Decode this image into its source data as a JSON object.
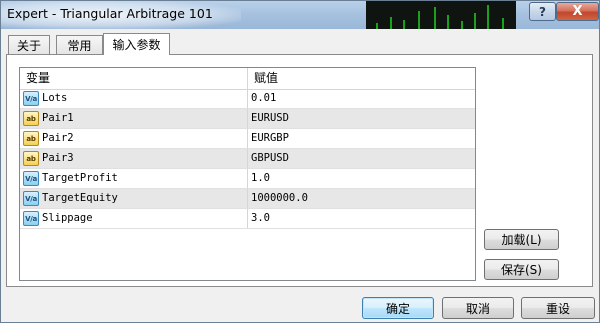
{
  "window": {
    "title": "Expert - Triangular Arbitrage 101",
    "help_label": "?",
    "close_label": "X"
  },
  "tabs": [
    {
      "label": "关于"
    },
    {
      "label": "常用"
    },
    {
      "label": "输入参数"
    }
  ],
  "active_tab": "输入参数",
  "grid": {
    "headers": {
      "name": "变量",
      "value": "赋值"
    },
    "rows": [
      {
        "type": "Val",
        "icon_text": "V/a",
        "name": "Lots",
        "value": "0.01"
      },
      {
        "type": "ab",
        "icon_text": "ab",
        "name": "Pair1",
        "value": "EURUSD"
      },
      {
        "type": "ab",
        "icon_text": "ab",
        "name": "Pair2",
        "value": "EURGBP"
      },
      {
        "type": "ab",
        "icon_text": "ab",
        "name": "Pair3",
        "value": "GBPUSD"
      },
      {
        "type": "Val",
        "icon_text": "V/a",
        "name": "TargetProfit",
        "value": "1.0"
      },
      {
        "type": "Val",
        "icon_text": "V/a",
        "name": "TargetEquity",
        "value": "1000000.0"
      },
      {
        "type": "Val",
        "icon_text": "V/a",
        "name": "Slippage",
        "value": "3.0"
      }
    ]
  },
  "side_buttons": {
    "load": "加载(L)",
    "save": "保存(S)"
  },
  "footer_buttons": {
    "ok": "确定",
    "cancel": "取消",
    "reset": "重设"
  }
}
